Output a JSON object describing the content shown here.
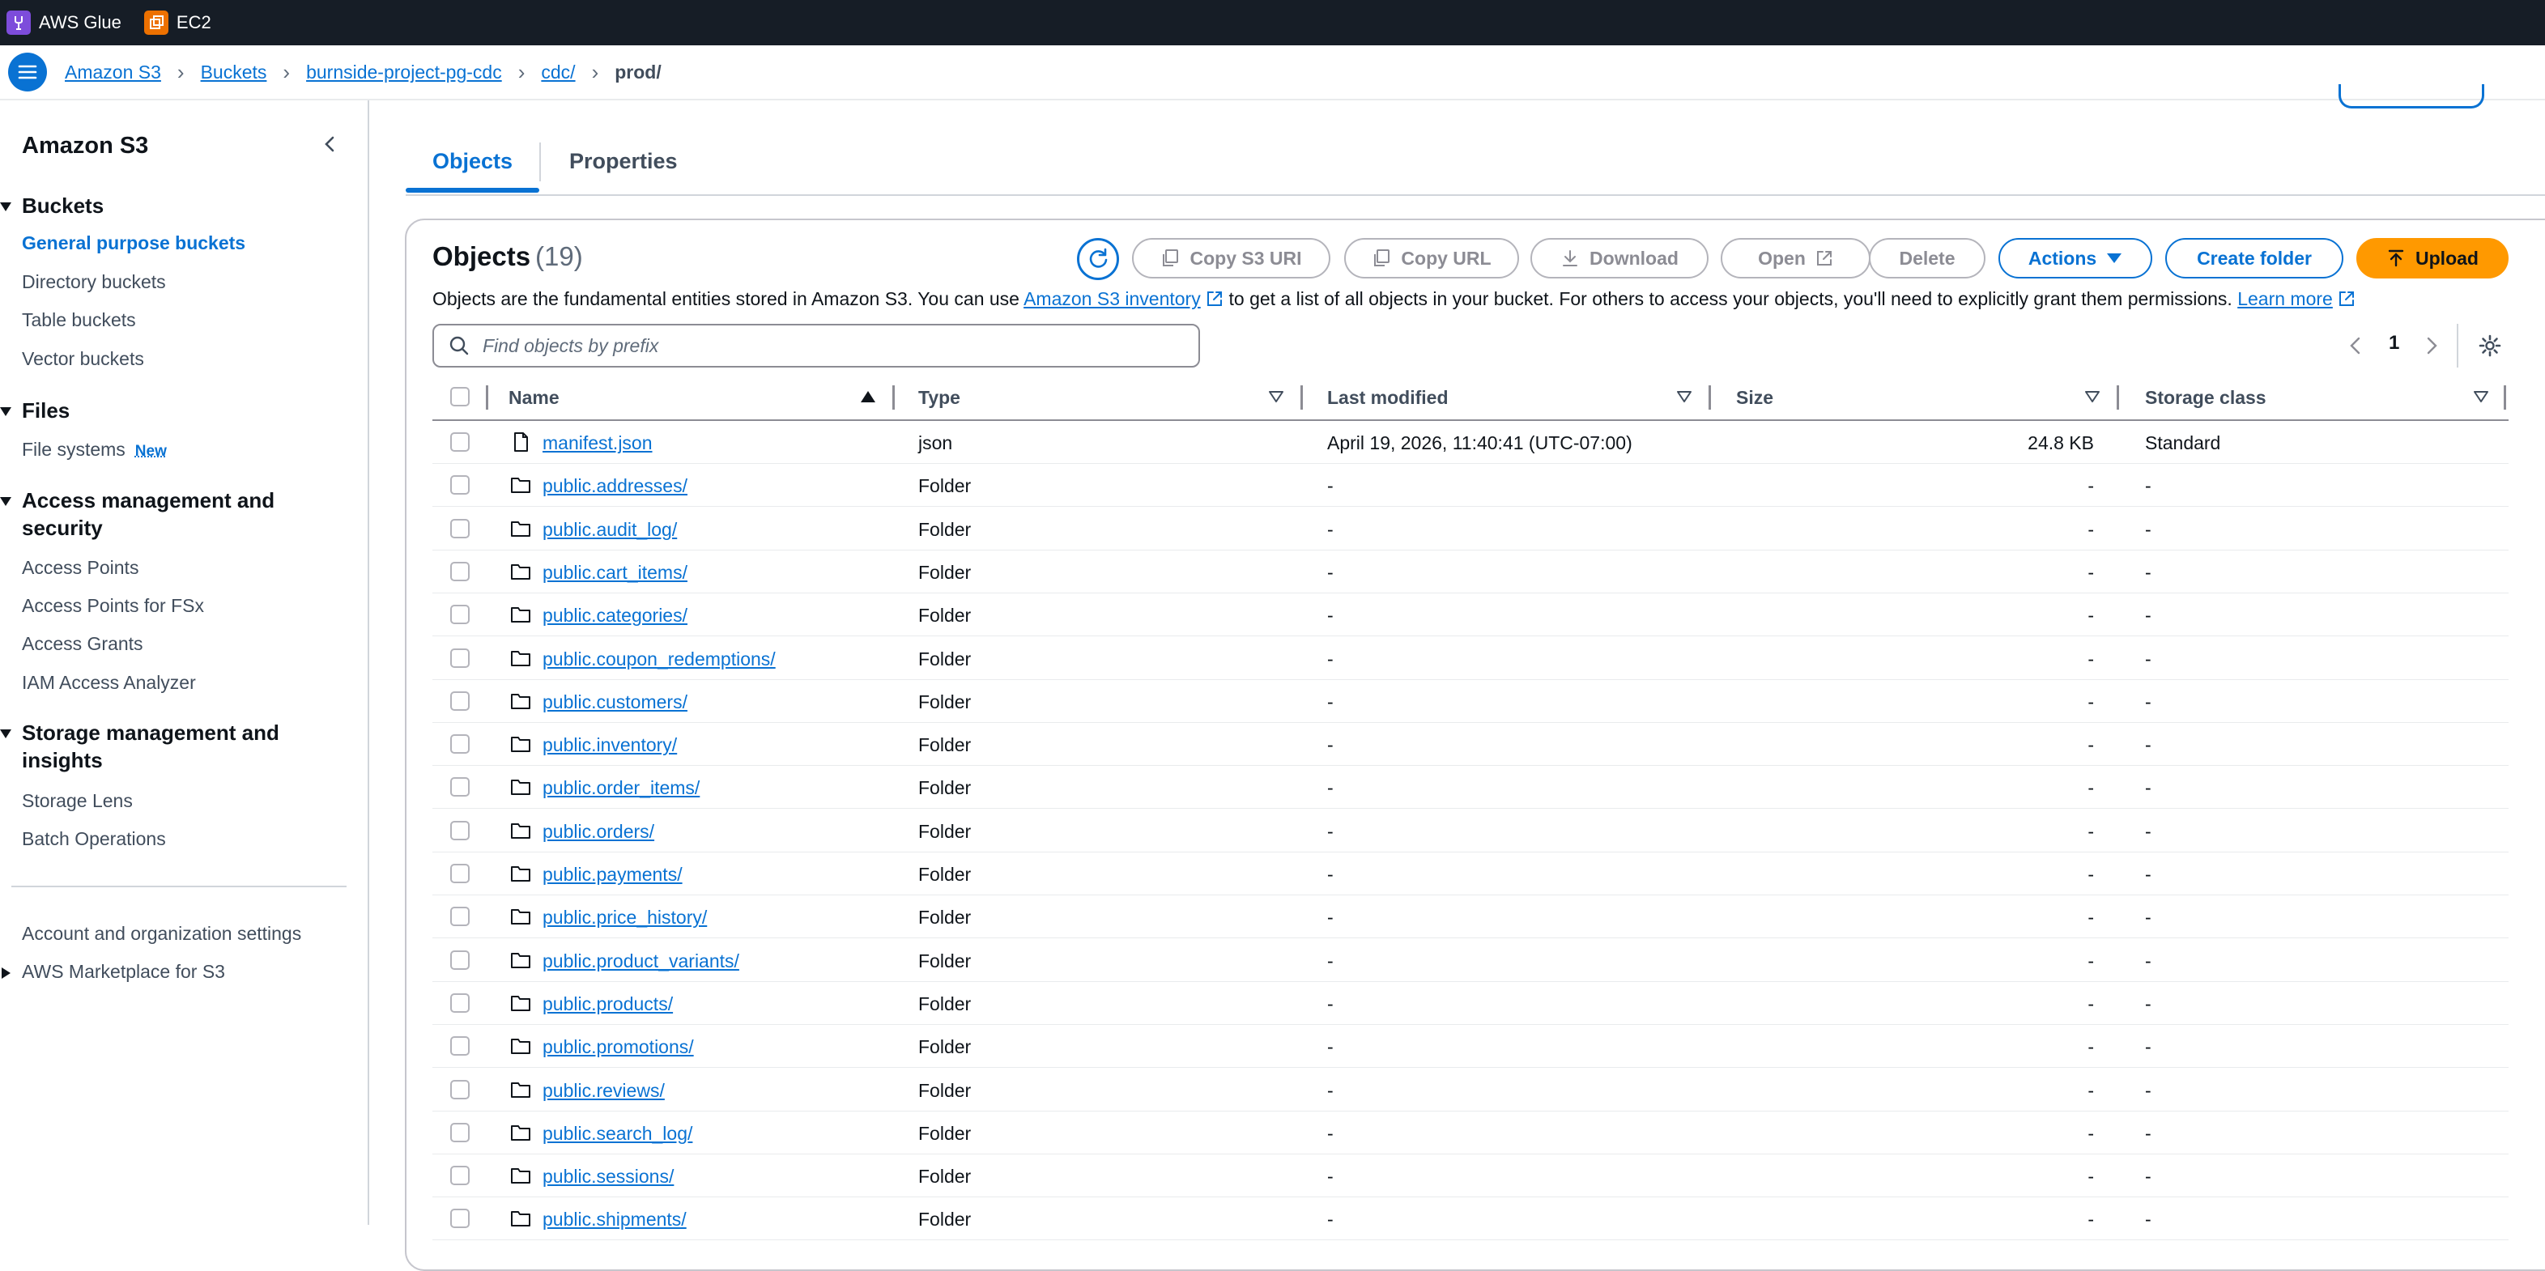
{
  "topbar": {
    "services": [
      {
        "label": "AWS Glue",
        "color": "#7d4cdb",
        "icon": "glue-icon"
      },
      {
        "label": "EC2",
        "color": "#ed7100",
        "icon": "ec2-icon"
      }
    ]
  },
  "breadcrumb": {
    "items": [
      "Amazon S3",
      "Buckets",
      "burnside-project-pg-cdc",
      "cdc/"
    ],
    "current": "prod/"
  },
  "sidebar": {
    "title": "Amazon S3",
    "sections": [
      {
        "title": "Buckets",
        "items": [
          "General purpose buckets",
          "Directory buckets",
          "Table buckets",
          "Vector buckets"
        ]
      },
      {
        "title": "Files",
        "items": [
          "File systems"
        ],
        "badge": "New"
      },
      {
        "title": "Access management and security",
        "items": [
          "Access Points",
          "Access Points for FSx",
          "Access Grants",
          "IAM Access Analyzer"
        ]
      },
      {
        "title": "Storage management and insights",
        "items": [
          "Storage Lens",
          "Batch Operations"
        ]
      }
    ],
    "footer": [
      "Account and organization settings",
      "AWS Marketplace for S3"
    ]
  },
  "tabs": [
    "Objects",
    "Properties"
  ],
  "objects_panel": {
    "title": "Objects",
    "count": "(19)",
    "buttons": {
      "copy_s3_uri": "Copy S3 URI",
      "copy_url": "Copy URL",
      "download": "Download",
      "open": "Open",
      "delete": "Delete",
      "actions": "Actions",
      "create_folder": "Create folder",
      "upload": "Upload"
    },
    "description": {
      "pre": "Objects are the fundamental entities stored in Amazon S3. You can use ",
      "link1": "Amazon S3 inventory",
      "mid": " to get a list of all objects in your bucket. For others to access your objects, you'll need to explicitly grant them permissions. ",
      "link2": "Learn more"
    },
    "search_placeholder": "Find objects by prefix",
    "page": "1"
  },
  "table": {
    "columns": [
      "Name",
      "Type",
      "Last modified",
      "Size",
      "Storage class"
    ],
    "rows": [
      {
        "name": "manifest.json",
        "kind": "file",
        "type": "json",
        "modified": "April 19, 2026, 11:40:41 (UTC-07:00)",
        "size": "24.8 KB",
        "storage": "Standard"
      },
      {
        "name": "public.addresses/",
        "kind": "folder",
        "type": "Folder",
        "modified": "-",
        "size": "-",
        "storage": "-"
      },
      {
        "name": "public.audit_log/",
        "kind": "folder",
        "type": "Folder",
        "modified": "-",
        "size": "-",
        "storage": "-"
      },
      {
        "name": "public.cart_items/",
        "kind": "folder",
        "type": "Folder",
        "modified": "-",
        "size": "-",
        "storage": "-"
      },
      {
        "name": "public.categories/",
        "kind": "folder",
        "type": "Folder",
        "modified": "-",
        "size": "-",
        "storage": "-"
      },
      {
        "name": "public.coupon_redemptions/",
        "kind": "folder",
        "type": "Folder",
        "modified": "-",
        "size": "-",
        "storage": "-"
      },
      {
        "name": "public.customers/",
        "kind": "folder",
        "type": "Folder",
        "modified": "-",
        "size": "-",
        "storage": "-"
      },
      {
        "name": "public.inventory/",
        "kind": "folder",
        "type": "Folder",
        "modified": "-",
        "size": "-",
        "storage": "-"
      },
      {
        "name": "public.order_items/",
        "kind": "folder",
        "type": "Folder",
        "modified": "-",
        "size": "-",
        "storage": "-"
      },
      {
        "name": "public.orders/",
        "kind": "folder",
        "type": "Folder",
        "modified": "-",
        "size": "-",
        "storage": "-"
      },
      {
        "name": "public.payments/",
        "kind": "folder",
        "type": "Folder",
        "modified": "-",
        "size": "-",
        "storage": "-"
      },
      {
        "name": "public.price_history/",
        "kind": "folder",
        "type": "Folder",
        "modified": "-",
        "size": "-",
        "storage": "-"
      },
      {
        "name": "public.product_variants/",
        "kind": "folder",
        "type": "Folder",
        "modified": "-",
        "size": "-",
        "storage": "-"
      },
      {
        "name": "public.products/",
        "kind": "folder",
        "type": "Folder",
        "modified": "-",
        "size": "-",
        "storage": "-"
      },
      {
        "name": "public.promotions/",
        "kind": "folder",
        "type": "Folder",
        "modified": "-",
        "size": "-",
        "storage": "-"
      },
      {
        "name": "public.reviews/",
        "kind": "folder",
        "type": "Folder",
        "modified": "-",
        "size": "-",
        "storage": "-"
      },
      {
        "name": "public.search_log/",
        "kind": "folder",
        "type": "Folder",
        "modified": "-",
        "size": "-",
        "storage": "-"
      },
      {
        "name": "public.sessions/",
        "kind": "folder",
        "type": "Folder",
        "modified": "-",
        "size": "-",
        "storage": "-"
      },
      {
        "name": "public.shipments/",
        "kind": "folder",
        "type": "Folder",
        "modified": "-",
        "size": "-",
        "storage": "-"
      }
    ]
  },
  "colors": {
    "accent": "#0972d3",
    "upload": "#ff9900",
    "topbar": "#161d26"
  }
}
